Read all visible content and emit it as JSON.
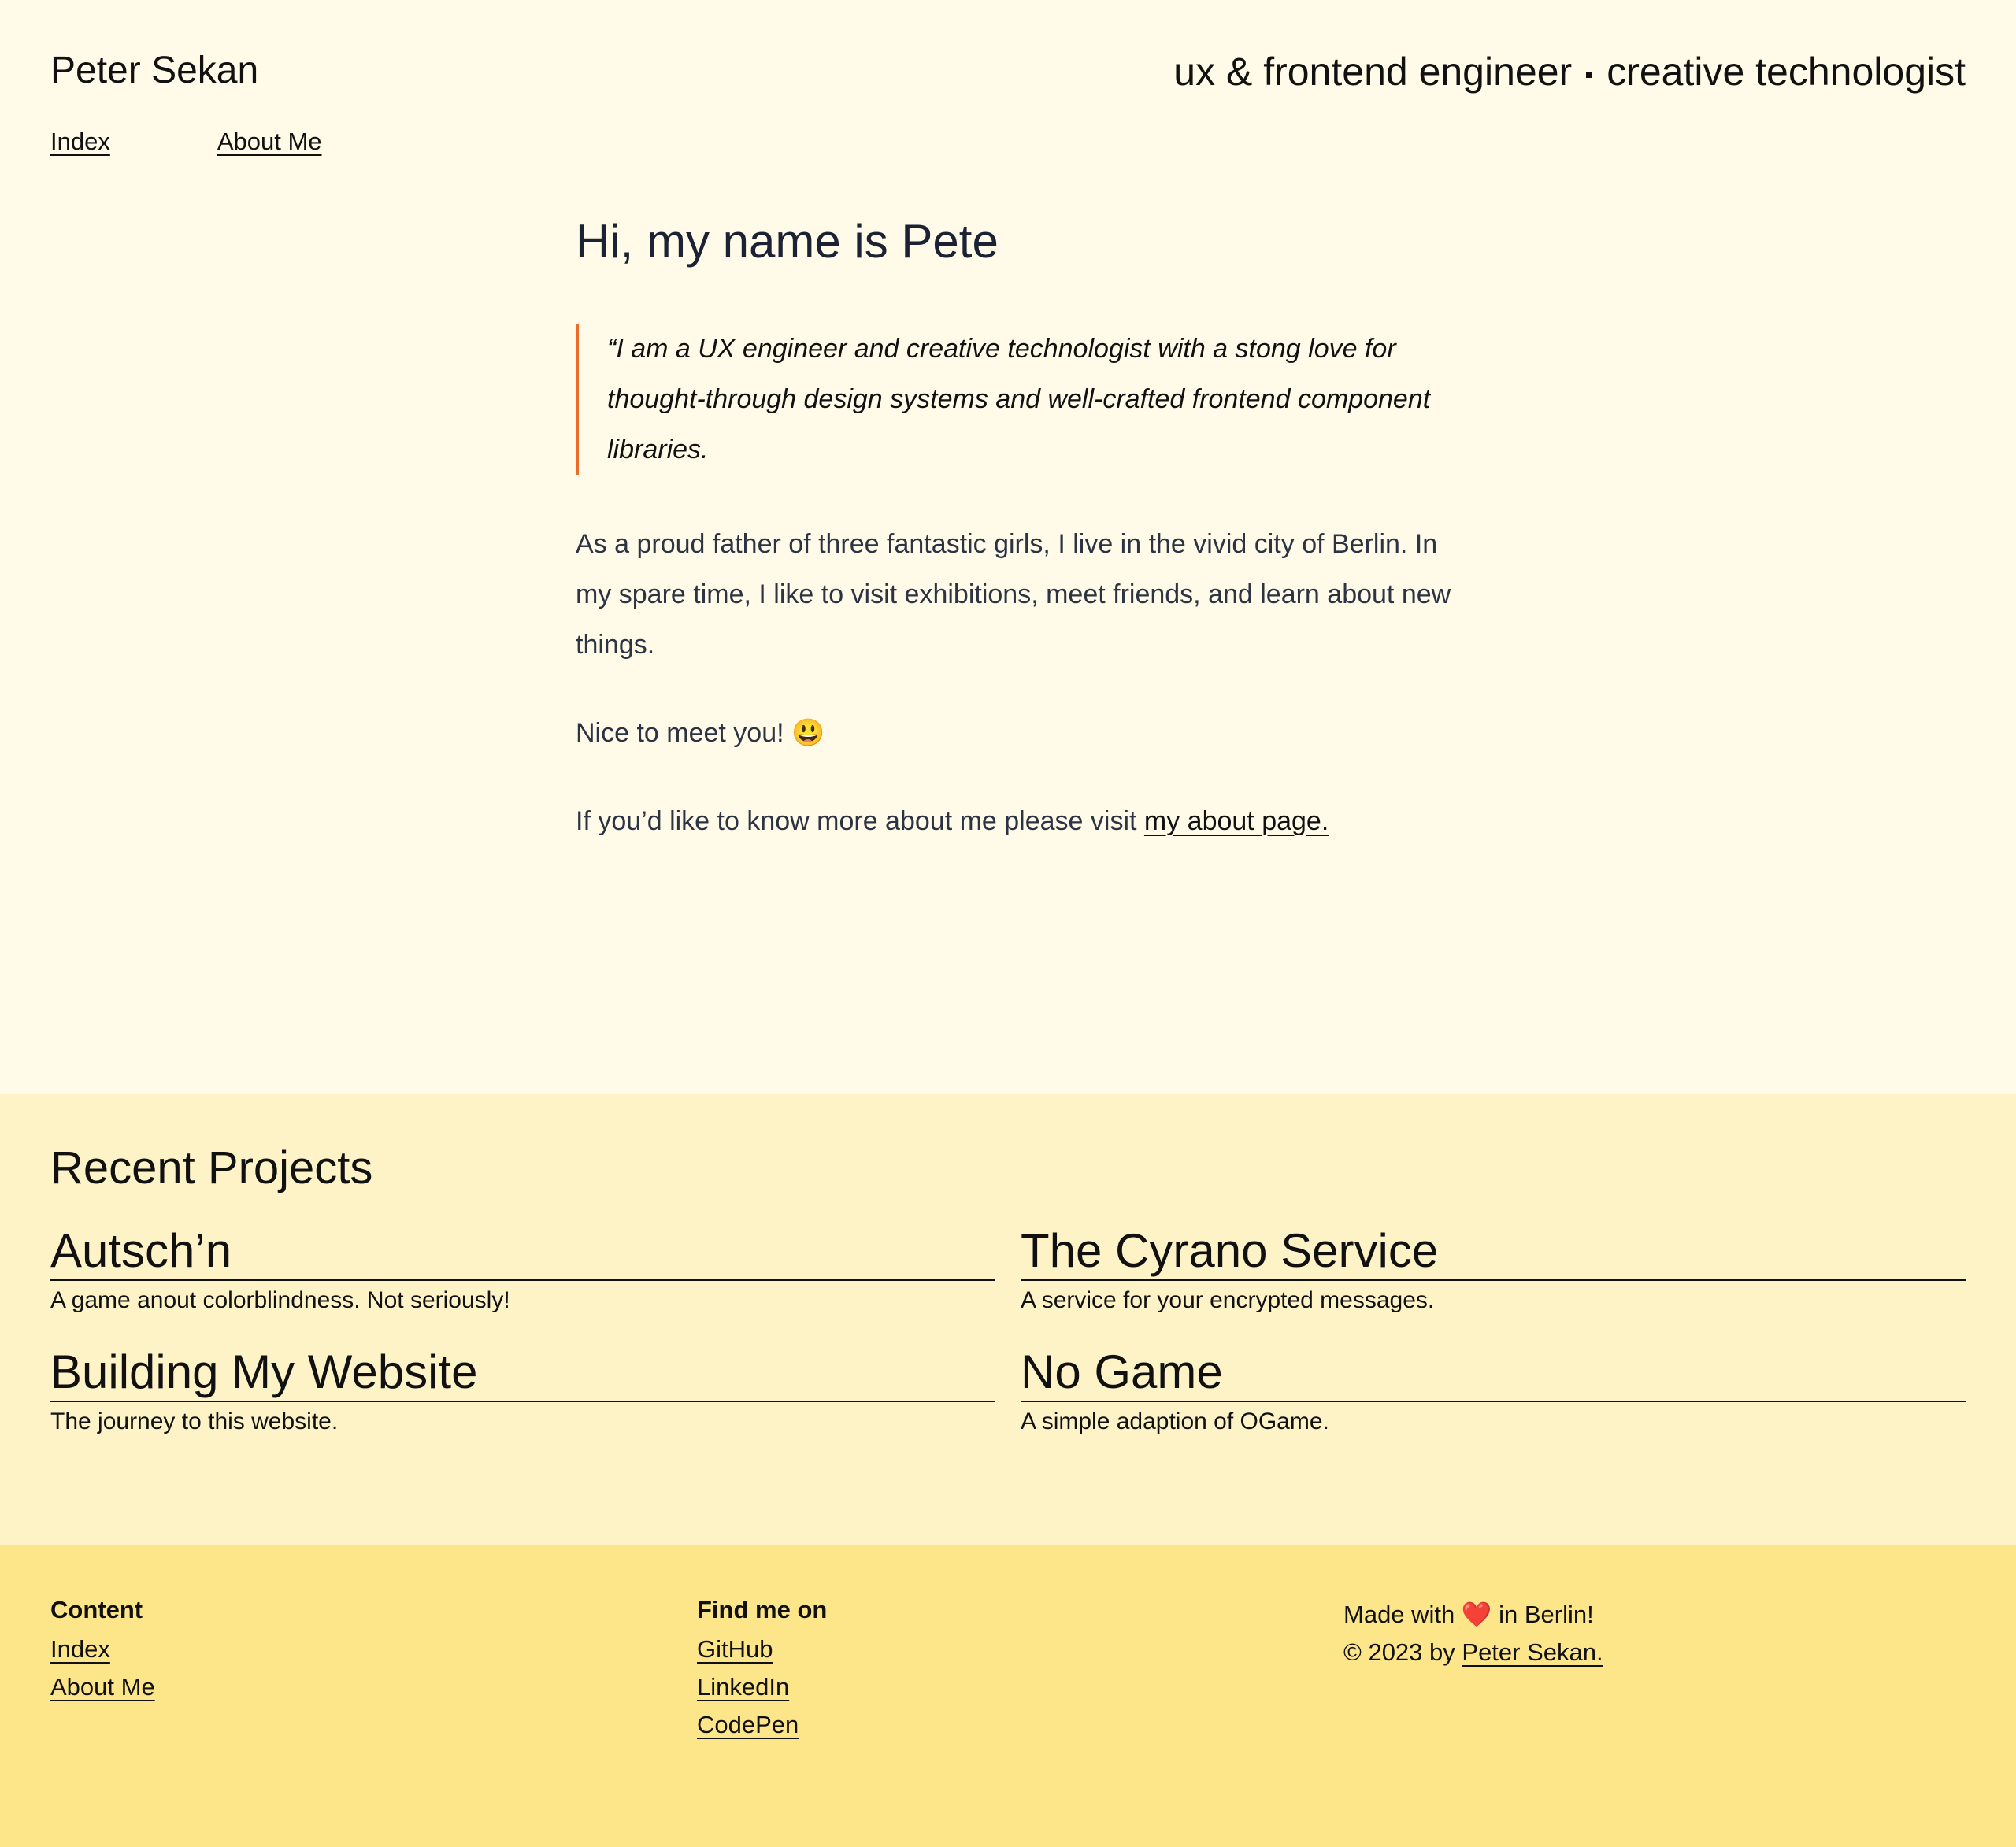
{
  "header": {
    "site_name": "Peter Sekan",
    "tagline_left": "ux & frontend engineer",
    "tagline_right": "creative technologist",
    "nav": [
      {
        "label": "Index"
      },
      {
        "label": "About Me"
      }
    ]
  },
  "intro": {
    "heading": "Hi, my name is Pete",
    "quote": "“I am a UX engineer and creative technologist with a stong love for thought-through design systems and well-crafted frontend component libraries.",
    "paragraph_1": "As a proud father of three fantastic girls, I live in the vivid city of Berlin. In my spare time, I like to visit exhibitions, meet friends, and learn about new things.",
    "paragraph_2": "Nice to meet you! 😃",
    "paragraph_3_prefix": "If you’d like to know more about me please visit ",
    "paragraph_3_link": "my about page."
  },
  "projects": {
    "title": "Recent Projects",
    "items": [
      {
        "title": "Autsch’n",
        "description": "A game anout colorblindness. Not seriously!"
      },
      {
        "title": "The Cyrano Service",
        "description": "A service for your encrypted messages."
      },
      {
        "title": "Building My Website",
        "description": "The journey to this website."
      },
      {
        "title": "No Game",
        "description": "A simple adaption of OGame."
      }
    ]
  },
  "footer": {
    "content": {
      "title": "Content",
      "links": [
        {
          "label": "Index"
        },
        {
          "label": "About Me"
        }
      ]
    },
    "find_me": {
      "title": "Find me on",
      "links": [
        {
          "label": "GitHub"
        },
        {
          "label": "LinkedIn"
        },
        {
          "label": "CodePen"
        }
      ]
    },
    "made_prefix": "Made with ",
    "heart": "❤️",
    "made_suffix": " in Berlin!",
    "copyright_prefix": "© 2023 by ",
    "copyright_link": "Peter Sekan."
  },
  "colors": {
    "page_background": "#fffbe8",
    "projects_background": "#fef3c7",
    "footer_background": "#fde68a",
    "quote_accent": "#ea6b2a"
  }
}
